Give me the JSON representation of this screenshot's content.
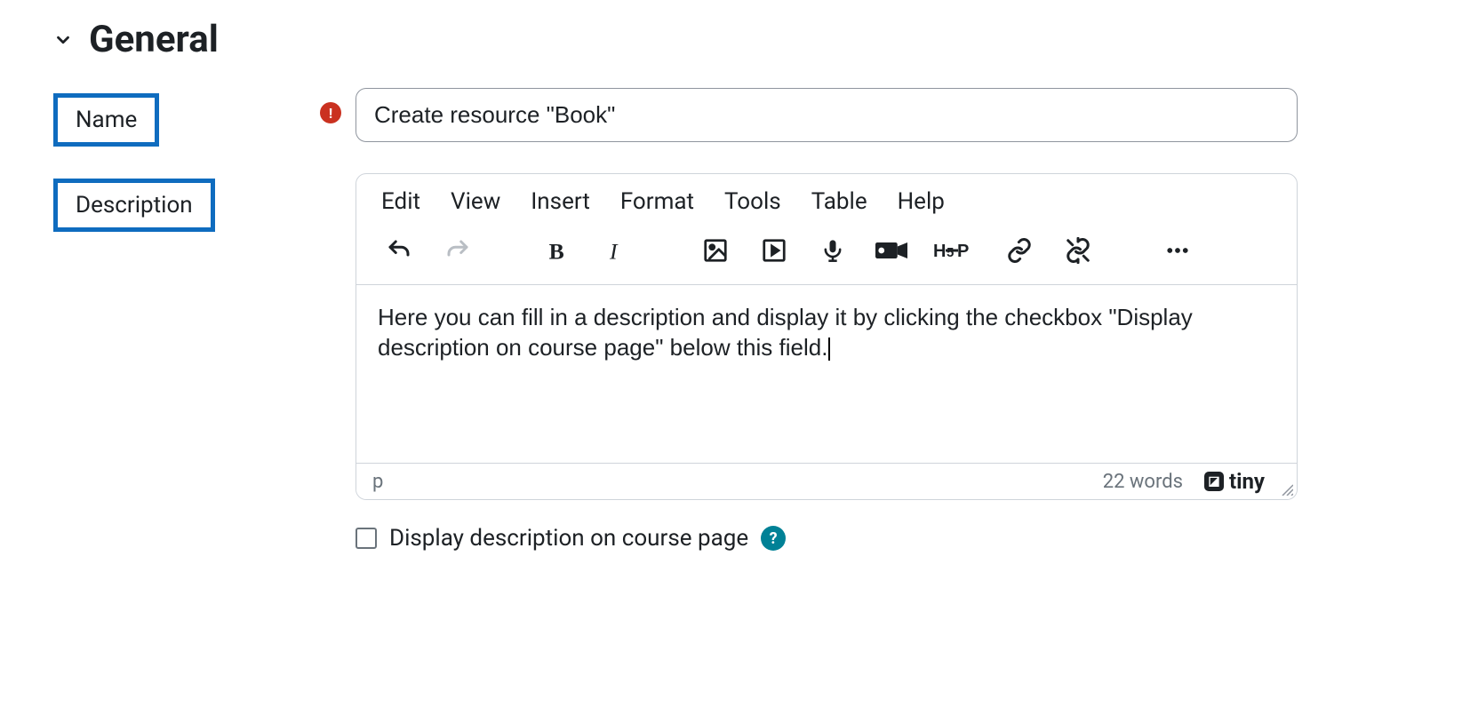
{
  "section": {
    "title": "General"
  },
  "fields": {
    "name": {
      "label": "Name",
      "required": true,
      "value": "Create resource \"Book\""
    },
    "description": {
      "label": "Description",
      "body": "Here you can fill in a description and display it by clicking the checkbox \"Display description on course page\" below this field."
    }
  },
  "editor": {
    "menubar": [
      "Edit",
      "View",
      "Insert",
      "Format",
      "Tools",
      "Table",
      "Help"
    ],
    "status_path": "p",
    "status_words": "22 words",
    "brand": "tiny"
  },
  "checkbox": {
    "display_desc_label": "Display description on course page"
  }
}
